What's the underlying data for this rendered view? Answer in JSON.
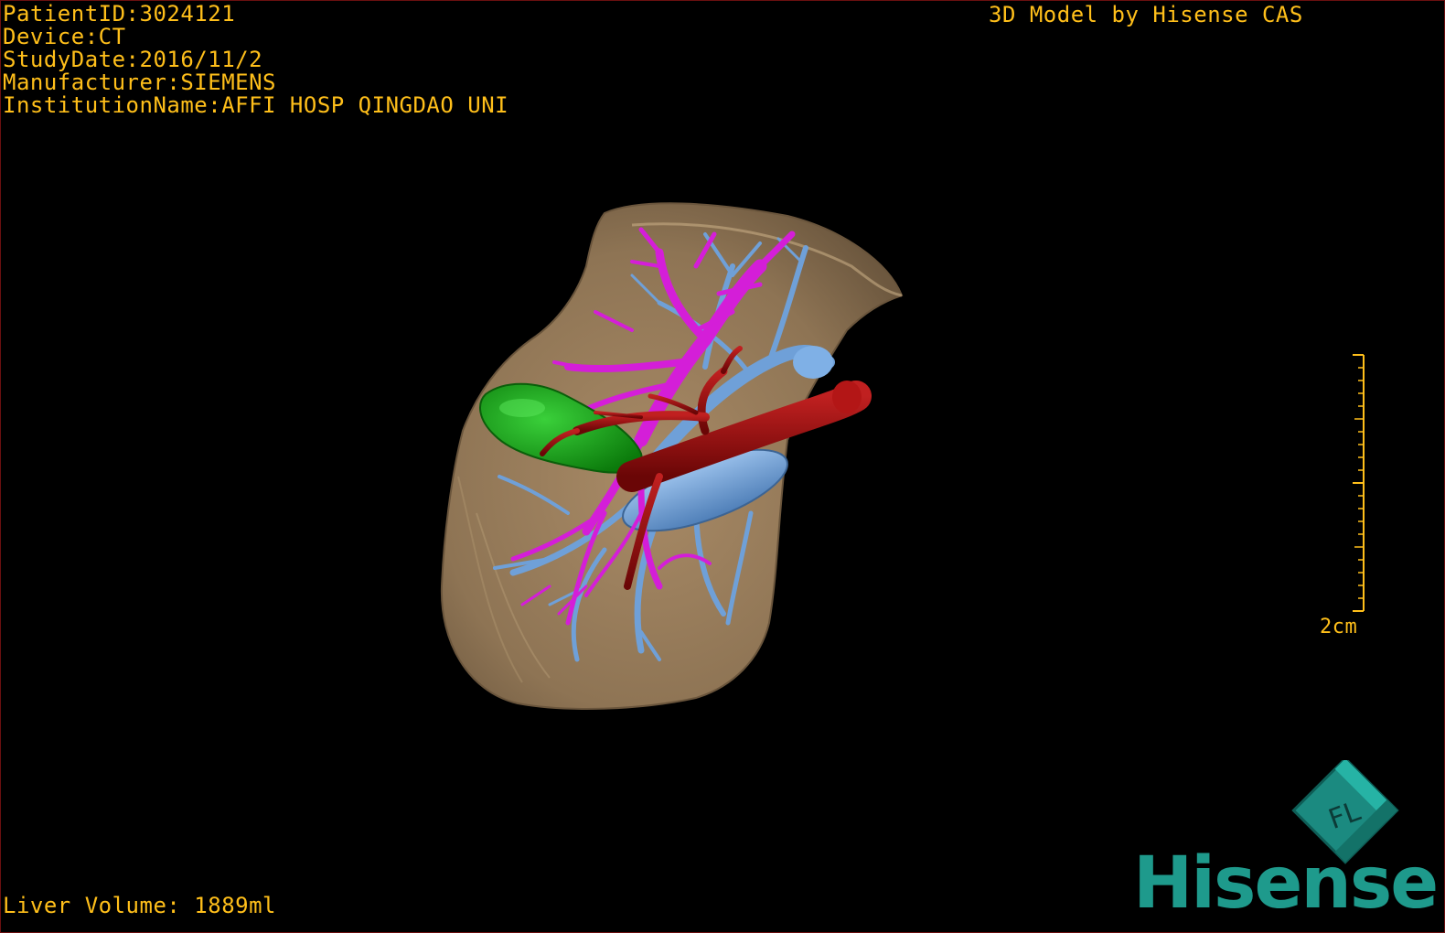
{
  "dicom_info": {
    "patient_id": "PatientID:3024121",
    "device": "Device:CT",
    "study_date": "StudyDate:2016/11/2",
    "manufacturer": "Manufacturer:SIEMENS",
    "institution": "InstitutionName:AFFI HOSP QINGDAO UNI"
  },
  "model_credit": "3D Model by Hisense CAS",
  "liver_volume": "Liver Volume: 1889ml",
  "scale_bar": {
    "label": "2cm"
  },
  "logo": {
    "brand": "Hisense",
    "cube_letters": "FL"
  },
  "colors": {
    "overlay_text": "#ffbf1a",
    "liver": "#9c8060",
    "portal_vein": "#d41ed8",
    "hepatic_vein": "#6fa0d8",
    "artery": "#9a0c0c",
    "gallbladder": "#16a216",
    "brand": "#1e9a8c"
  },
  "icons": [
    "orientation-cube-icon",
    "hisense-logo"
  ]
}
